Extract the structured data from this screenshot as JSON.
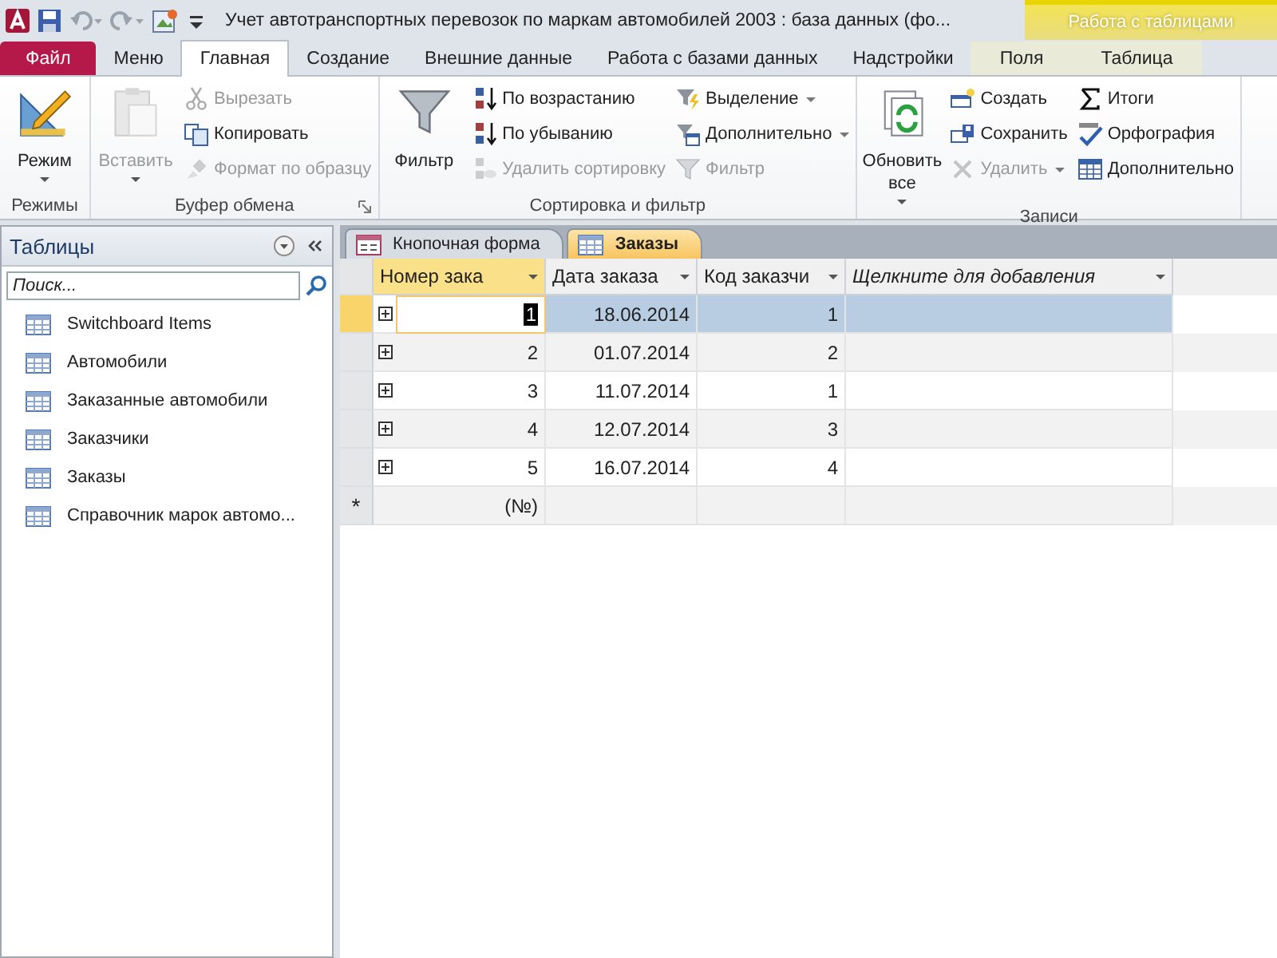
{
  "window": {
    "title": "Учет автотранспортных перевозок по маркам автомобилей 2003 : база данных (фо..."
  },
  "contextual_group": {
    "label": "Работа с таблицами"
  },
  "ribbon_tabs": [
    {
      "label": "Файл",
      "kind": "file",
      "selected": false
    },
    {
      "label": "Меню",
      "kind": "normal",
      "selected": false
    },
    {
      "label": "Главная",
      "kind": "normal",
      "selected": true
    },
    {
      "label": "Создание",
      "kind": "normal",
      "selected": false
    },
    {
      "label": "Внешние данные",
      "kind": "normal",
      "selected": false
    },
    {
      "label": "Работа с базами данных",
      "kind": "normal",
      "selected": false
    },
    {
      "label": "Надстройки",
      "kind": "normal",
      "selected": false
    },
    {
      "label": "Поля",
      "kind": "context",
      "selected": false
    },
    {
      "label": "Таблица",
      "kind": "context",
      "selected": false
    }
  ],
  "ribbon_groups": [
    {
      "label": "Режимы",
      "launcher": false,
      "columns": [
        [
          {
            "label": "Режим",
            "kind": "large",
            "disabled": false,
            "dropdown": true
          }
        ]
      ]
    },
    {
      "label": "Буфер обмена",
      "launcher": true,
      "columns": [
        [
          {
            "label": "Вставить",
            "kind": "large",
            "disabled": true,
            "dropdown": true
          }
        ],
        [
          {
            "label": "Вырезать",
            "kind": "small",
            "disabled": true,
            "dropdown": false
          },
          {
            "label": "Копировать",
            "kind": "small",
            "disabled": false,
            "dropdown": false
          },
          {
            "label": "Формат по образцу",
            "kind": "small",
            "disabled": true,
            "dropdown": false
          }
        ]
      ]
    },
    {
      "label": "Сортировка и фильтр",
      "launcher": false,
      "columns": [
        [
          {
            "label": "Фильтр",
            "kind": "large",
            "disabled": false,
            "dropdown": false
          }
        ],
        [
          {
            "label": "По возрастанию",
            "kind": "small",
            "disabled": false,
            "dropdown": false
          },
          {
            "label": "По убыванию",
            "kind": "small",
            "disabled": false,
            "dropdown": false
          },
          {
            "label": "Удалить сортировку",
            "kind": "small",
            "disabled": true,
            "dropdown": false
          }
        ],
        [
          {
            "label": "Выделение",
            "kind": "small",
            "disabled": false,
            "dropdown": true
          },
          {
            "label": "Дополнительно",
            "kind": "small",
            "disabled": false,
            "dropdown": true
          },
          {
            "label": "Фильтр",
            "kind": "small",
            "disabled": true,
            "dropdown": false
          }
        ]
      ]
    },
    {
      "label": "Записи",
      "launcher": false,
      "columns": [
        [
          {
            "label": "Обновить все",
            "kind": "large",
            "disabled": false,
            "dropdown": true
          }
        ],
        [
          {
            "label": "Создать",
            "kind": "small",
            "disabled": false,
            "dropdown": false
          },
          {
            "label": "Сохранить",
            "kind": "small",
            "disabled": false,
            "dropdown": false
          },
          {
            "label": "Удалить",
            "kind": "small",
            "disabled": true,
            "dropdown": true
          }
        ],
        [
          {
            "label": "Итоги",
            "kind": "small",
            "disabled": false,
            "dropdown": false
          },
          {
            "label": "Орфография",
            "kind": "small",
            "disabled": false,
            "dropdown": false
          },
          {
            "label": "Дополнительно",
            "kind": "small",
            "disabled": false,
            "dropdown": false
          }
        ]
      ]
    }
  ],
  "navigation": {
    "title": "Таблицы",
    "search": {
      "placeholder": "Поиск..."
    },
    "items": [
      {
        "label": "Switchboard Items"
      },
      {
        "label": "Автомобили"
      },
      {
        "label": "Заказанные автомобили"
      },
      {
        "label": "Заказчики"
      },
      {
        "label": "Заказы"
      },
      {
        "label": "Справочник марок автомо..."
      }
    ]
  },
  "document_tabs": [
    {
      "label": "Кнопочная форма",
      "kind": "form",
      "selected": false
    },
    {
      "label": "Заказы",
      "kind": "table",
      "selected": true
    }
  ],
  "datasheet": {
    "columns": [
      {
        "label": "Номер зака",
        "kind": "field",
        "selected": true
      },
      {
        "label": "Дата заказа",
        "kind": "field",
        "selected": false
      },
      {
        "label": "Код заказчи",
        "kind": "field",
        "selected": false
      },
      {
        "label": "Щелкните для добавления",
        "kind": "add",
        "selected": false
      }
    ],
    "rows": [
      {
        "cells": [
          "1",
          "18.06.2014",
          "1"
        ],
        "selected": true
      },
      {
        "cells": [
          "2",
          "01.07.2014",
          "2"
        ],
        "selected": false
      },
      {
        "cells": [
          "3",
          "11.07.2014",
          "1"
        ],
        "selected": false
      },
      {
        "cells": [
          "4",
          "12.07.2014",
          "3"
        ],
        "selected": false
      },
      {
        "cells": [
          "5",
          "16.07.2014",
          "4"
        ],
        "selected": false
      }
    ],
    "new_row": {
      "marker": "*",
      "placeholder": "(№)"
    }
  }
}
